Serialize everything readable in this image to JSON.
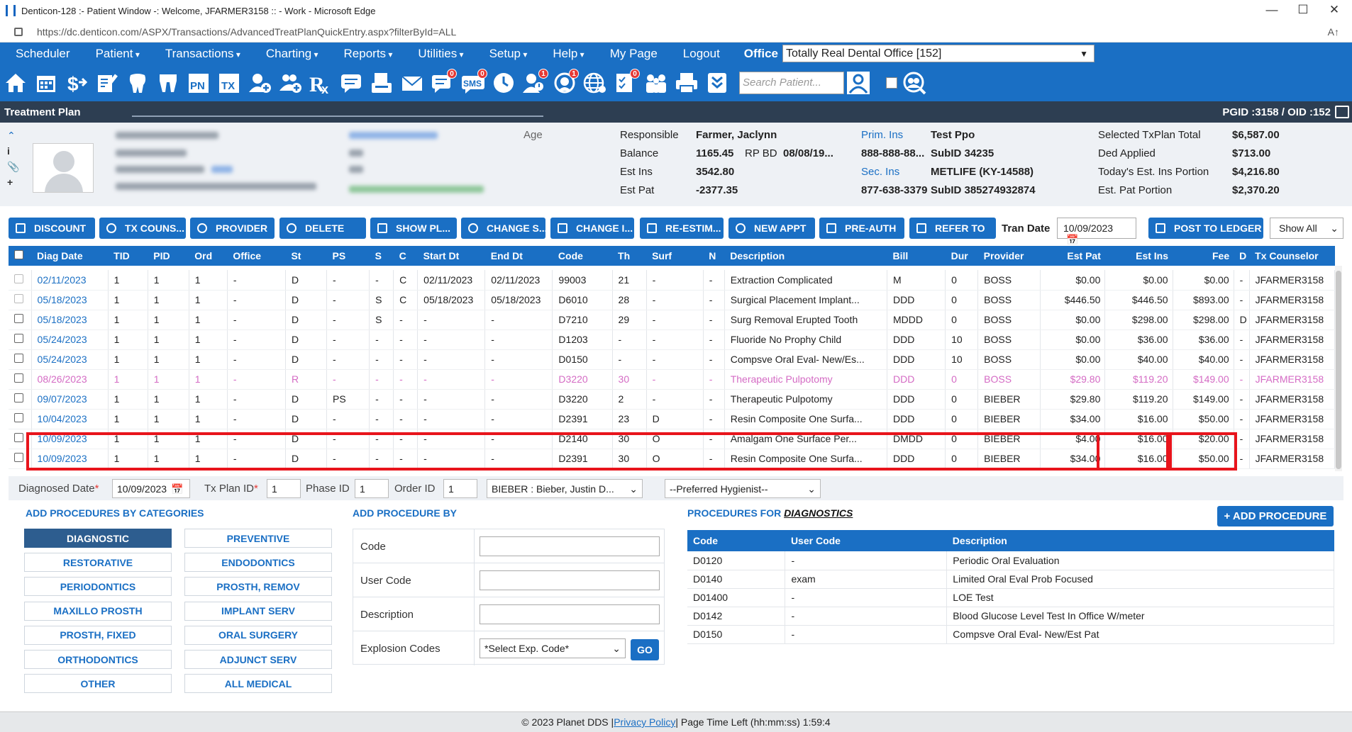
{
  "window": {
    "title": "Denticon-128 :- Patient Window -: Welcome, JFARMER3158 :: - Work - Microsoft Edge",
    "url": "https://dc.denticon.com/ASPX/Transactions/AdvancedTreatPlanQuickEntry.aspx?filterById=ALL",
    "minimize": "—",
    "maximize": "☐",
    "close": "✕",
    "reader": "A↑"
  },
  "menu": {
    "items": [
      "Scheduler",
      "Patient",
      "Transactions",
      "Charting",
      "Reports",
      "Utilities",
      "Setup",
      "Help",
      "My Page",
      "Logout"
    ],
    "office_label": "Office",
    "office_value": "Totally Real Dental Office [152]"
  },
  "toolbar": {
    "search_placeholder": "Search Patient...",
    "icons": [
      {
        "name": "home-icon"
      },
      {
        "name": "calendar-icon"
      },
      {
        "name": "dollar-icon"
      },
      {
        "name": "notes-icon"
      },
      {
        "name": "tooth-icon"
      },
      {
        "name": "teeth-chart-icon"
      },
      {
        "name": "pn-icon",
        "text": "PN"
      },
      {
        "name": "tx-icon",
        "text": "TX"
      },
      {
        "name": "add-patient-icon"
      },
      {
        "name": "add-family-icon"
      },
      {
        "name": "rx-icon",
        "text": "Rx"
      },
      {
        "name": "message-icon"
      },
      {
        "name": "scan-icon"
      },
      {
        "name": "email-icon"
      },
      {
        "name": "chat-icon",
        "badge": "0"
      },
      {
        "name": "sms-icon",
        "text": "SMS",
        "badge": "0"
      },
      {
        "name": "clock-icon"
      },
      {
        "name": "alert-user-icon",
        "badge": "1"
      },
      {
        "name": "support-icon",
        "badge": "1"
      },
      {
        "name": "globe-icon"
      },
      {
        "name": "checklist-icon",
        "badge": "0"
      },
      {
        "name": "family-icon"
      },
      {
        "name": "printer-icon"
      },
      {
        "name": "form-icon"
      }
    ]
  },
  "section": {
    "title": "Treatment Plan",
    "ids": "PGID :3158  /  OID :152"
  },
  "patient_info": {
    "age_label": "Age",
    "responsible_label": "Responsible",
    "responsible_value": "Farmer, Jaclynn",
    "balance_label": "Balance",
    "balance_value": "1165.45",
    "rpbd_label": "RP BD",
    "rpbd_value": "08/08/19...",
    "est_ins_label": "Est Ins",
    "est_ins_value": "3542.80",
    "est_pat_label": "Est Pat",
    "est_pat_value": "-2377.35",
    "prim_ins_label": "Prim. Ins",
    "prim_ins_value": "Test Ppo",
    "prim_phone": "888-888-88...",
    "prim_subid": "SubID 34235",
    "sec_ins_label": "Sec. Ins",
    "sec_ins_value": "METLIFE (KY-14588)",
    "sec_phone": "877-638-3379",
    "sec_subid": "SubID 385274932874",
    "selected_total_label": "Selected TxPlan Total",
    "selected_total_value": "$6,587.00",
    "ded_applied_label": "Ded Applied",
    "ded_applied_value": "$713.00",
    "today_ins_label": "Today's Est. Ins Portion",
    "today_ins_value": "$4,216.80",
    "est_pat_portion_label": "Est. Pat Portion",
    "est_pat_portion_value": "$2,370.20"
  },
  "actions": {
    "discount": "DISCOUNT",
    "tx_counselor": "TX COUNS...",
    "provider": "PROVIDER",
    "delete": "DELETE",
    "show_plan": "SHOW PL...",
    "change_status": "CHANGE S...",
    "change_ins": "CHANGE I...",
    "re_estimate": "RE-ESTIM...",
    "new_appt": "NEW APPT",
    "pre_auth": "PRE-AUTH",
    "refer_to": "REFER TO",
    "tran_date_label": "Tran Date",
    "tran_date_value": "10/09/2023",
    "post_to_ledger": "POST TO LEDGER",
    "show_all": "Show All"
  },
  "grid": {
    "columns": [
      "",
      "Diag Date",
      "TID",
      "PID",
      "Ord",
      "Office",
      "St",
      "PS",
      "S",
      "C",
      "Start Dt",
      "End Dt",
      "Code",
      "Th",
      "Surf",
      "N",
      "Description",
      "Bill",
      "Dur",
      "Provider",
      "Est Pat",
      "Est Ins",
      "Fee",
      "D",
      "Tx Counselor"
    ],
    "rows": [
      {
        "diag": "02/11/2023",
        "tid": "1",
        "pid": "1",
        "ord": "1",
        "office": "-",
        "st": "D",
        "ps": "-",
        "s": "-",
        "c": "C",
        "start": "02/11/2023",
        "end": "02/11/2023",
        "code": "99003",
        "th": "21",
        "surf": "-",
        "n": "-",
        "desc": "Extraction Complicated",
        "bill": "M",
        "dur": "0",
        "prov": "BOSS",
        "estpat": "$0.00",
        "estins": "$0.00",
        "fee": "$0.00",
        "d": "-",
        "counselor": "JFARMER3158",
        "style": "dim"
      },
      {
        "diag": "05/18/2023",
        "tid": "1",
        "pid": "1",
        "ord": "1",
        "office": "-",
        "st": "D",
        "ps": "-",
        "s": "S",
        "c": "C",
        "start": "05/18/2023",
        "end": "05/18/2023",
        "code": "D6010",
        "th": "28",
        "surf": "-",
        "n": "-",
        "desc": "Surgical Placement Implant...",
        "bill": "DDD",
        "dur": "0",
        "prov": "BOSS",
        "estpat": "$446.50",
        "estins": "$446.50",
        "fee": "$893.00",
        "d": "-",
        "counselor": "JFARMER3158",
        "style": "dim"
      },
      {
        "diag": "05/18/2023",
        "tid": "1",
        "pid": "1",
        "ord": "1",
        "office": "-",
        "st": "D",
        "ps": "-",
        "s": "S",
        "c": "-",
        "start": "-",
        "end": "-",
        "code": "D7210",
        "th": "29",
        "surf": "-",
        "n": "-",
        "desc": "Surg Removal Erupted Tooth",
        "bill": "MDDD",
        "dur": "0",
        "prov": "BOSS",
        "estpat": "$0.00",
        "estins": "$298.00",
        "fee": "$298.00",
        "d": "D",
        "counselor": "JFARMER3158",
        "style": ""
      },
      {
        "diag": "05/24/2023",
        "tid": "1",
        "pid": "1",
        "ord": "1",
        "office": "-",
        "st": "D",
        "ps": "-",
        "s": "-",
        "c": "-",
        "start": "-",
        "end": "-",
        "code": "D1203",
        "th": "-",
        "surf": "-",
        "n": "-",
        "desc": "Fluoride No Prophy Child",
        "bill": "DDD",
        "dur": "10",
        "prov": "BOSS",
        "estpat": "$0.00",
        "estins": "$36.00",
        "fee": "$36.00",
        "d": "-",
        "counselor": "JFARMER3158",
        "style": ""
      },
      {
        "diag": "05/24/2023",
        "tid": "1",
        "pid": "1",
        "ord": "1",
        "office": "-",
        "st": "D",
        "ps": "-",
        "s": "-",
        "c": "-",
        "start": "-",
        "end": "-",
        "code": "D0150",
        "th": "-",
        "surf": "-",
        "n": "-",
        "desc": "Compsve Oral Eval- New/Es...",
        "bill": "DDD",
        "dur": "10",
        "prov": "BOSS",
        "estpat": "$0.00",
        "estins": "$40.00",
        "fee": "$40.00",
        "d": "-",
        "counselor": "JFARMER3158",
        "style": ""
      },
      {
        "diag": "08/26/2023",
        "tid": "1",
        "pid": "1",
        "ord": "1",
        "office": "-",
        "st": "R",
        "ps": "-",
        "s": "-",
        "c": "-",
        "start": "-",
        "end": "-",
        "code": "D3220",
        "th": "30",
        "surf": "-",
        "n": "-",
        "desc": "Therapeutic Pulpotomy",
        "bill": "DDD",
        "dur": "0",
        "prov": "BOSS",
        "estpat": "$29.80",
        "estins": "$119.20",
        "fee": "$149.00",
        "d": "-",
        "counselor": "JFARMER3158",
        "style": "r"
      },
      {
        "diag": "09/07/2023",
        "tid": "1",
        "pid": "1",
        "ord": "1",
        "office": "-",
        "st": "D",
        "ps": "PS",
        "s": "-",
        "c": "-",
        "start": "-",
        "end": "-",
        "code": "D3220",
        "th": "2",
        "surf": "-",
        "n": "-",
        "desc": "Therapeutic Pulpotomy",
        "bill": "DDD",
        "dur": "0",
        "prov": "BIEBER",
        "estpat": "$29.80",
        "estins": "$119.20",
        "fee": "$149.00",
        "d": "-",
        "counselor": "JFARMER3158",
        "style": ""
      },
      {
        "diag": "10/04/2023",
        "tid": "1",
        "pid": "1",
        "ord": "1",
        "office": "-",
        "st": "D",
        "ps": "-",
        "s": "-",
        "c": "-",
        "start": "-",
        "end": "-",
        "code": "D2391",
        "th": "23",
        "surf": "D",
        "n": "-",
        "desc": "Resin Composite One Surfa...",
        "bill": "DDD",
        "dur": "0",
        "prov": "BIEBER",
        "estpat": "$34.00",
        "estins": "$16.00",
        "fee": "$50.00",
        "d": "-",
        "counselor": "JFARMER3158",
        "style": ""
      },
      {
        "diag": "10/09/2023",
        "tid": "1",
        "pid": "1",
        "ord": "1",
        "office": "-",
        "st": "D",
        "ps": "-",
        "s": "-",
        "c": "-",
        "start": "-",
        "end": "-",
        "code": "D2140",
        "th": "30",
        "surf": "O",
        "n": "-",
        "desc": "Amalgam One Surface Per...",
        "bill": "DMDD",
        "dur": "0",
        "prov": "BIEBER",
        "estpat": "$4.00",
        "estins": "$16.00",
        "fee": "$20.00",
        "d": "-",
        "counselor": "JFARMER3158",
        "style": ""
      },
      {
        "diag": "10/09/2023",
        "tid": "1",
        "pid": "1",
        "ord": "1",
        "office": "-",
        "st": "D",
        "ps": "-",
        "s": "-",
        "c": "-",
        "start": "-",
        "end": "-",
        "code": "D2391",
        "th": "30",
        "surf": "O",
        "n": "-",
        "desc": "Resin Composite One Surfa...",
        "bill": "DDD",
        "dur": "0",
        "prov": "BIEBER",
        "estpat": "$34.00",
        "estins": "$16.00",
        "fee": "$50.00",
        "d": "-",
        "counselor": "JFARMER3158",
        "style": ""
      }
    ]
  },
  "entry": {
    "diag_label": "Diagnosed Date",
    "diag_value": "10/09/2023",
    "txplan_label": "Tx Plan ID",
    "txplan_value": "1",
    "phase_label": "Phase ID",
    "phase_value": "1",
    "order_label": "Order ID",
    "order_value": "1",
    "provider_value": "BIEBER : Bieber, Justin D...",
    "hygienist_value": "--Preferred Hygienist--"
  },
  "categories": {
    "title": "ADD PROCEDURES BY CATEGORIES",
    "items": [
      "DIAGNOSTIC",
      "PREVENTIVE",
      "RESTORATIVE",
      "ENDODONTICS",
      "PERIODONTICS",
      "PROSTH, REMOV",
      "MAXILLO PROSTH",
      "IMPLANT SERV",
      "PROSTH, FIXED",
      "ORAL SURGERY",
      "ORTHODONTICS",
      "ADJUNCT SERV",
      "OTHER",
      "ALL MEDICAL"
    ]
  },
  "add_by": {
    "title": "ADD PROCEDURE BY",
    "code_label": "Code",
    "user_code_label": "User Code",
    "description_label": "Description",
    "explosion_label": "Explosion Codes",
    "explosion_value": "*Select Exp. Code*",
    "go": "GO"
  },
  "procedures": {
    "title_prefix": "PROCEDURES FOR",
    "title_category": "DIAGNOSTICS",
    "add_button": "+ ADD PROCEDURE",
    "columns": [
      "Code",
      "User Code",
      "Description"
    ],
    "rows": [
      [
        "D0120",
        "-",
        "Periodic Oral Evaluation"
      ],
      [
        "D0140",
        "exam",
        "Limited Oral Eval Prob Focused"
      ],
      [
        "D01400",
        "-",
        "LOE Test"
      ],
      [
        "D0142",
        "-",
        "Blood Glucose Level Test In Office W/meter"
      ],
      [
        "D0150",
        "-",
        "Compsve Oral Eval- New/Est Pat"
      ]
    ]
  },
  "footer": {
    "copyright": "© 2023 Planet DDS | ",
    "privacy": "Privacy Policy",
    "time_left": " |  Page Time Left (hh:mm:ss) 1:59:4"
  }
}
